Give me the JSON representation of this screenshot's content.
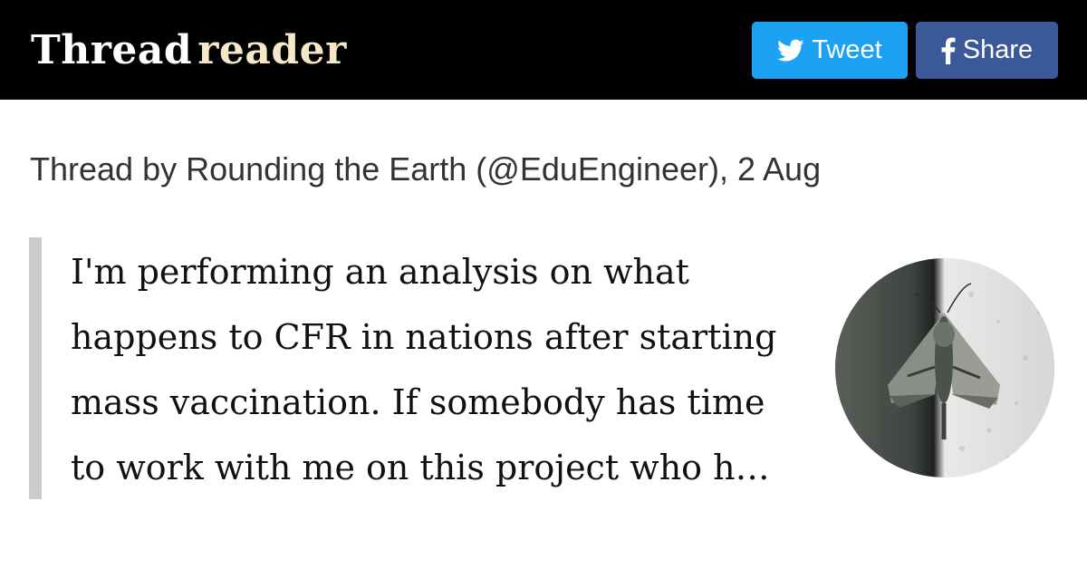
{
  "header": {
    "logo_part1": "Thread",
    "logo_part2": "reader",
    "tweet_button": {
      "label": "Tweet",
      "icon": "twitter-bird-icon",
      "color": "#1da1f2"
    },
    "share_button": {
      "label": "Share",
      "icon": "facebook-f-icon",
      "color": "#3b5998"
    }
  },
  "thread": {
    "byline": "Thread by Rounding the Earth (@EduEngineer), 2 Aug",
    "lines": [
      "I'm performing an analysis on what",
      "happens to CFR in nations after starting",
      "mass vaccination. If somebody has time",
      "to work with me on this project who h…"
    ],
    "avatar_description": "moth-on-wall-photo"
  },
  "colors": {
    "topbar": "#000000",
    "logo_primary": "#ffffff",
    "logo_accent": "#f6e7c6",
    "quote_bar": "#cccccc"
  }
}
